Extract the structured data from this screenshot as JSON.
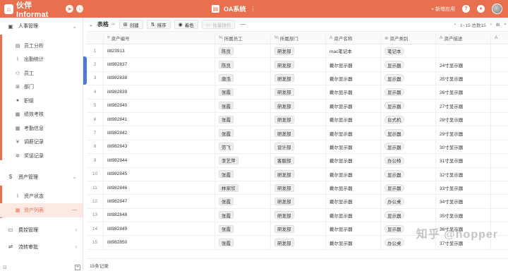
{
  "topbar": {
    "brand": "伙伴 Informat",
    "app_title": "OA系统",
    "new_app": "+ 新增应用",
    "app_menu_icon": "⋮",
    "help_icon": "?",
    "notify_icon": "♦"
  },
  "sidebar": {
    "groups": [
      {
        "label": "人事管理",
        "items": [
          "员工分析",
          "出勤统计",
          "员工",
          "部门",
          "职级",
          "绩效考核",
          "考勤信息",
          "调薪记录",
          "奖惩记录"
        ]
      },
      {
        "label": "资产管理",
        "items": [
          "资产状态",
          "资产列表"
        ]
      },
      {
        "label": "费控管理",
        "items": []
      },
      {
        "label": "流转审批",
        "items": []
      }
    ]
  },
  "toolbar": {
    "title": "表格",
    "create": "创建",
    "sort": "排序",
    "color": "着色",
    "batch": "批量操作",
    "more": "—",
    "pager": "1~15 总数15"
  },
  "table": {
    "headers": {
      "no": "资产编号",
      "employee": "所属员工",
      "dept": "所属部门",
      "name": "资产名称",
      "category": "资产类别",
      "desc": "资产描述"
    },
    "rows": [
      {
        "idx": "1",
        "no": "itit23913",
        "employee": "陈良",
        "dept": "研发部",
        "name": "mac笔记本",
        "category": "笔记本",
        "desc": ""
      },
      {
        "idx": "2",
        "no": "itit982837",
        "employee": "陈良",
        "dept": "研发部",
        "name": "戴尔显示器",
        "category": "显示器",
        "desc": "24寸显示器"
      },
      {
        "idx": "3",
        "no": "itit982838",
        "employee": "唐浩",
        "dept": "研发部",
        "name": "戴尔显示器",
        "category": "显示器",
        "desc": "25寸显示器"
      },
      {
        "idx": "4",
        "no": "itit982839",
        "employee": "张霞",
        "dept": "研发部",
        "name": "戴尔显示器",
        "category": "显示器",
        "desc": "26寸显示器"
      },
      {
        "idx": "5",
        "no": "itit982840",
        "employee": "张霞",
        "dept": "研发部",
        "name": "戴尔显示器",
        "category": "显示器",
        "desc": "27寸显示器"
      },
      {
        "idx": "6",
        "no": "itit982841",
        "employee": "张霞",
        "dept": "研发部",
        "name": "戴尔显示器",
        "category": "台式机",
        "desc": "28寸显示器"
      },
      {
        "idx": "7",
        "no": "itit982842",
        "employee": "张霞",
        "dept": "研发部",
        "name": "戴尔显示器",
        "category": "显示器",
        "desc": "29寸显示器"
      },
      {
        "idx": "8",
        "no": "itit982843",
        "employee": "劳飞",
        "dept": "设计部",
        "name": "戴尔显示器",
        "category": "显示器",
        "desc": "30寸显示器"
      },
      {
        "idx": "9",
        "no": "itit982844",
        "employee": "李艺萍",
        "dept": "客服部",
        "name": "戴尔显示器",
        "category": "办公椅",
        "desc": "31寸显示器"
      },
      {
        "idx": "10",
        "no": "itit982845",
        "employee": "张霞",
        "dept": "研发部",
        "name": "戴尔显示器",
        "category": "显示器",
        "desc": "32寸显示器"
      },
      {
        "idx": "11",
        "no": "itit982846",
        "employee": "林家欣",
        "dept": "研发部",
        "name": "戴尔显示器",
        "category": "显示器",
        "desc": "33寸显示器"
      },
      {
        "idx": "12",
        "no": "itit982847",
        "employee": "张霞",
        "dept": "研发部",
        "name": "戴尔显示器",
        "category": "办公桌",
        "desc": "34寸显示器"
      },
      {
        "idx": "13",
        "no": "itit982848",
        "employee": "张霞",
        "dept": "研发部",
        "name": "戴尔显示器",
        "category": "显示器",
        "desc": "35寸显示器"
      },
      {
        "idx": "14",
        "no": "itit982849",
        "employee": "张霞",
        "dept": "研发部",
        "name": "戴尔显示器",
        "category": "显示器",
        "desc": "36寸显示器"
      },
      {
        "idx": "15",
        "no": "itit982850",
        "employee": "张霞",
        "dept": "研发部",
        "name": "戴尔显示器",
        "category": "办公桌",
        "desc": "37寸显示器"
      }
    ]
  },
  "status": "15条记录",
  "watermark": "知乎 @hopper",
  "colors": {
    "accent": "#e8704f",
    "active_bg": "#fde9e3",
    "handle": "#4a7bd0"
  }
}
